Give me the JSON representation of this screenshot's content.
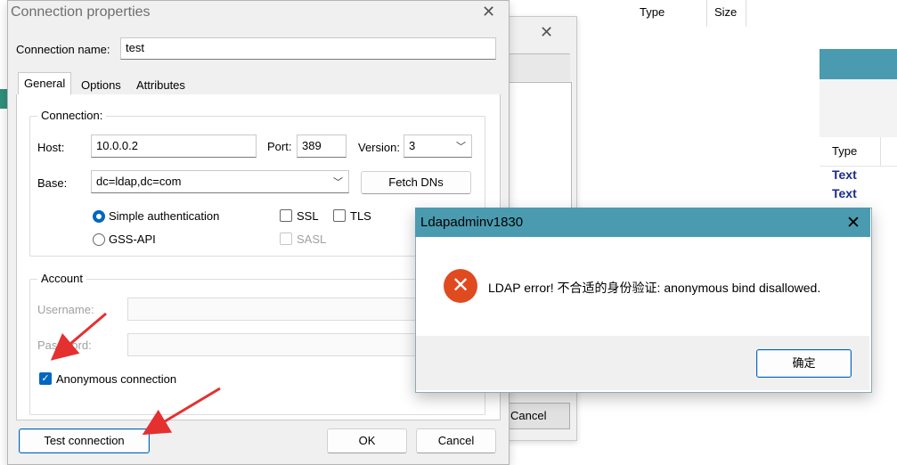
{
  "background": {
    "columns": [
      "Type",
      "Size"
    ],
    "right_table": {
      "header": "Type",
      "rows": [
        "Text",
        "Text"
      ]
    },
    "behind_dialog": {
      "cancel_label": "Cancel"
    }
  },
  "dialog": {
    "title": "Connection properties",
    "connection_name_label": "Connection name:",
    "connection_name_value": "test",
    "tabs": [
      "General",
      "Options",
      "Attributes"
    ],
    "connection_group": {
      "legend": "Connection:",
      "host_label": "Host:",
      "host_value": "10.0.0.2",
      "port_label": "Port:",
      "port_value": "389",
      "version_label": "Version:",
      "version_value": "3",
      "base_label": "Base:",
      "base_value": "dc=ldap,dc=com",
      "fetch_dns_label": "Fetch DNs",
      "simple_auth_label": "Simple authentication",
      "gss_api_label": "GSS-API",
      "ssl_label": "SSL",
      "tls_label": "TLS",
      "sasl_label": "SASL",
      "auth_selected": "Simple authentication"
    },
    "account_group": {
      "legend": "Account",
      "username_label": "Username:",
      "username_value": "",
      "password_label": "Password:",
      "password_value": "",
      "anonymous_label": "Anonymous connection",
      "anonymous_checked": true
    },
    "buttons": {
      "test_connection": "Test connection",
      "ok": "OK",
      "cancel": "Cancel"
    }
  },
  "message_box": {
    "title": "Ldapadminv1830",
    "message": "LDAP error! 不合适的身份验证: anonymous bind disallowed.",
    "ok_label": "确定",
    "icon": "error-icon"
  },
  "colors": {
    "accent": "#0067c0",
    "title_bar": "#4a9bb0",
    "error": "#e04a1f",
    "annotation_arrow": "#e53030"
  }
}
